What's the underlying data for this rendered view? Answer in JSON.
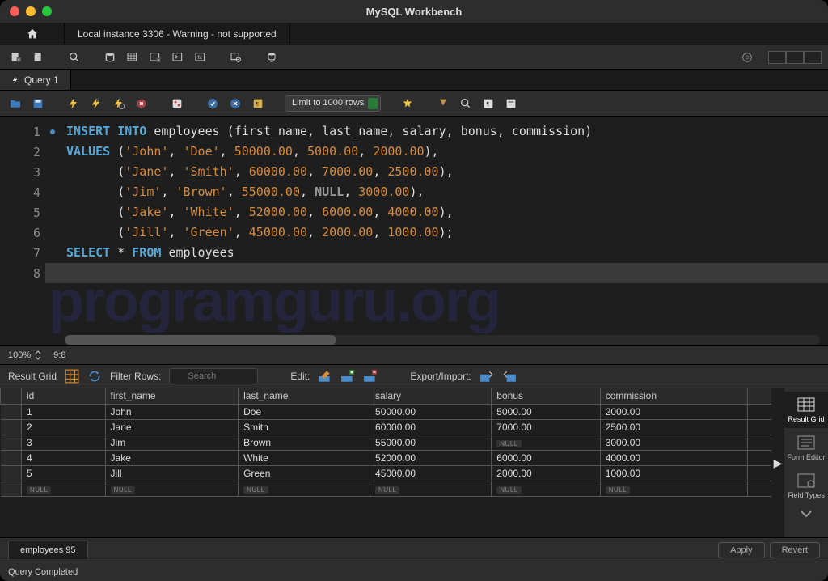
{
  "titlebar": {
    "title": "MySQL Workbench"
  },
  "connection_tab": {
    "label": "Local instance 3306 - Warning - not supported"
  },
  "query_tab": {
    "label": "Query 1"
  },
  "limit": {
    "label": "Limit to 1000 rows"
  },
  "editor": {
    "zoom": "100%",
    "cursor": "9:8",
    "lines": [
      {
        "n": 1,
        "dot": true,
        "tokens": [
          [
            "kw",
            "INSERT"
          ],
          [
            "pn",
            " "
          ],
          [
            "kw",
            "INTO"
          ],
          [
            "pn",
            " "
          ],
          [
            "ident",
            "employees"
          ],
          [
            "pn",
            " ("
          ],
          [
            "ident",
            "first_name"
          ],
          [
            "pn",
            ", "
          ],
          [
            "ident",
            "last_name"
          ],
          [
            "pn",
            ", "
          ],
          [
            "ident",
            "salary"
          ],
          [
            "pn",
            ", "
          ],
          [
            "ident",
            "bonus"
          ],
          [
            "pn",
            ", "
          ],
          [
            "ident",
            "commission"
          ],
          [
            "pn",
            ")"
          ]
        ]
      },
      {
        "n": 2,
        "dot": false,
        "tokens": [
          [
            "kw",
            "VALUES"
          ],
          [
            "pn",
            " ("
          ],
          [
            "str",
            "'John'"
          ],
          [
            "pn",
            ", "
          ],
          [
            "str",
            "'Doe'"
          ],
          [
            "pn",
            ", "
          ],
          [
            "num",
            "50000.00"
          ],
          [
            "pn",
            ", "
          ],
          [
            "num",
            "5000.00"
          ],
          [
            "pn",
            ", "
          ],
          [
            "num",
            "2000.00"
          ],
          [
            "pn",
            "),"
          ]
        ]
      },
      {
        "n": 3,
        "dot": false,
        "tokens": [
          [
            "pn",
            "       ("
          ],
          [
            "str",
            "'Jane'"
          ],
          [
            "pn",
            ", "
          ],
          [
            "str",
            "'Smith'"
          ],
          [
            "pn",
            ", "
          ],
          [
            "num",
            "60000.00"
          ],
          [
            "pn",
            ", "
          ],
          [
            "num",
            "7000.00"
          ],
          [
            "pn",
            ", "
          ],
          [
            "num",
            "2500.00"
          ],
          [
            "pn",
            "),"
          ]
        ]
      },
      {
        "n": 4,
        "dot": false,
        "tokens": [
          [
            "pn",
            "       ("
          ],
          [
            "str",
            "'Jim'"
          ],
          [
            "pn",
            ", "
          ],
          [
            "str",
            "'Brown'"
          ],
          [
            "pn",
            ", "
          ],
          [
            "num",
            "55000.00"
          ],
          [
            "pn",
            ", "
          ],
          [
            "null",
            "NULL"
          ],
          [
            "pn",
            ", "
          ],
          [
            "num",
            "3000.00"
          ],
          [
            "pn",
            "),"
          ]
        ]
      },
      {
        "n": 5,
        "dot": false,
        "tokens": [
          [
            "pn",
            "       ("
          ],
          [
            "str",
            "'Jake'"
          ],
          [
            "pn",
            ", "
          ],
          [
            "str",
            "'White'"
          ],
          [
            "pn",
            ", "
          ],
          [
            "num",
            "52000.00"
          ],
          [
            "pn",
            ", "
          ],
          [
            "num",
            "6000.00"
          ],
          [
            "pn",
            ", "
          ],
          [
            "num",
            "4000.00"
          ],
          [
            "pn",
            "),"
          ]
        ]
      },
      {
        "n": 6,
        "dot": false,
        "tokens": [
          [
            "pn",
            "       ("
          ],
          [
            "str",
            "'Jill'"
          ],
          [
            "pn",
            ", "
          ],
          [
            "str",
            "'Green'"
          ],
          [
            "pn",
            ", "
          ],
          [
            "num",
            "45000.00"
          ],
          [
            "pn",
            ", "
          ],
          [
            "num",
            "2000.00"
          ],
          [
            "pn",
            ", "
          ],
          [
            "num",
            "1000.00"
          ],
          [
            "pn",
            ");"
          ]
        ]
      },
      {
        "n": 7,
        "dot": false,
        "tokens": []
      },
      {
        "n": 8,
        "dot": true,
        "hl": true,
        "tokens": [
          [
            "kw",
            "SELECT"
          ],
          [
            "pn",
            " * "
          ],
          [
            "kw",
            "FROM"
          ],
          [
            "pn",
            " "
          ],
          [
            "ident",
            "employees"
          ]
        ]
      }
    ]
  },
  "watermark": "programguru.org",
  "result_toolbar": {
    "grid_label": "Result Grid",
    "filter_label": "Filter Rows:",
    "filter_placeholder": "Search",
    "edit_label": "Edit:",
    "export_label": "Export/Import:"
  },
  "grid": {
    "columns": [
      "id",
      "first_name",
      "last_name",
      "salary",
      "bonus",
      "commission"
    ],
    "rows": [
      [
        "1",
        "John",
        "Doe",
        "50000.00",
        "5000.00",
        "2000.00"
      ],
      [
        "2",
        "Jane",
        "Smith",
        "60000.00",
        "7000.00",
        "2500.00"
      ],
      [
        "3",
        "Jim",
        "Brown",
        "55000.00",
        null,
        "3000.00"
      ],
      [
        "4",
        "Jake",
        "White",
        "52000.00",
        "6000.00",
        "4000.00"
      ],
      [
        "5",
        "Jill",
        "Green",
        "45000.00",
        "2000.00",
        "1000.00"
      ]
    ]
  },
  "side": {
    "result_grid": "Result Grid",
    "form_editor": "Form Editor",
    "field_types": "Field Types"
  },
  "result_tab": {
    "label": "employees 95"
  },
  "buttons": {
    "apply": "Apply",
    "revert": "Revert"
  },
  "status": {
    "text": "Query Completed"
  }
}
